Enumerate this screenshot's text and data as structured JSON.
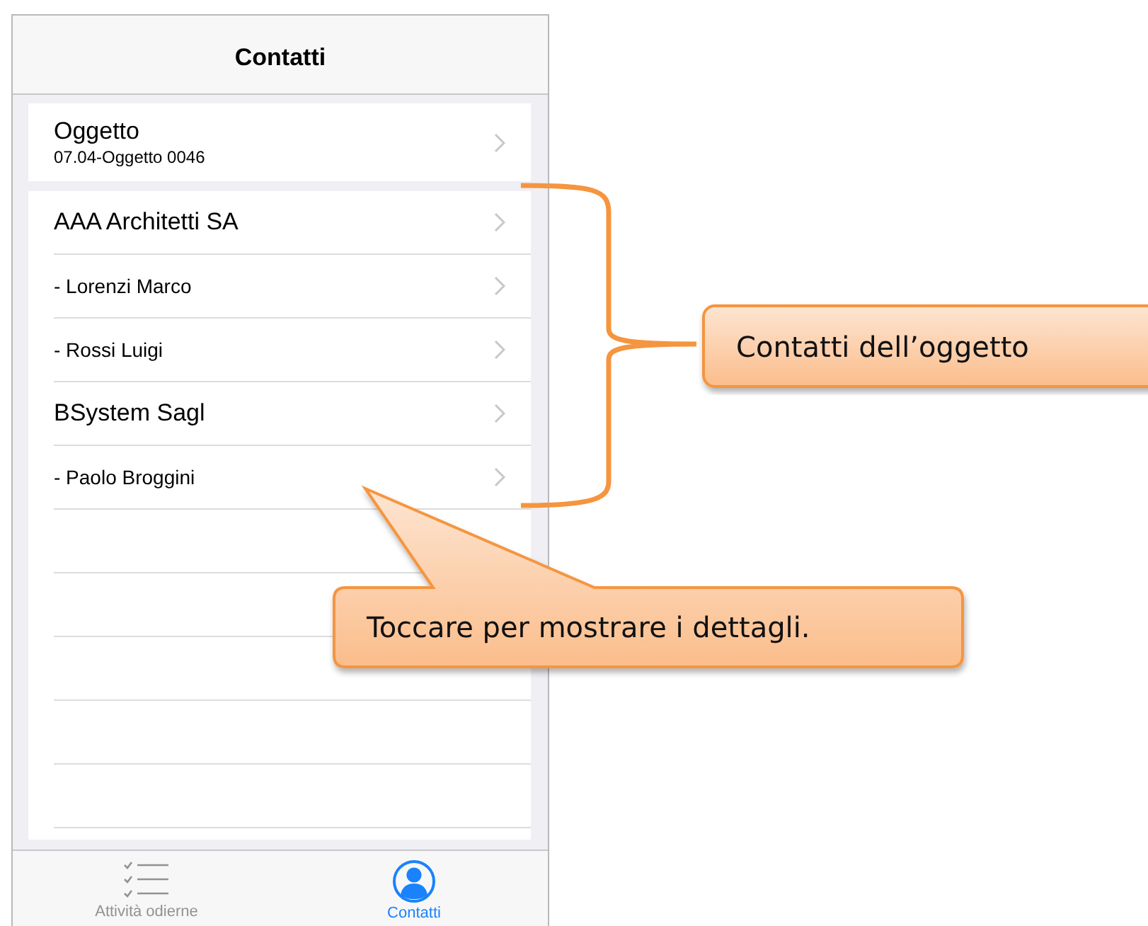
{
  "nav_bar": {
    "title": "Contatti"
  },
  "object_section": {
    "title": "Oggetto",
    "subtitle": "07.04-Oggetto 0046"
  },
  "contacts": [
    {
      "kind": "company",
      "name": "AAA Architetti SA"
    },
    {
      "kind": "person",
      "name": "- Lorenzi Marco"
    },
    {
      "kind": "person",
      "name": "- Rossi Luigi"
    },
    {
      "kind": "company",
      "name": "BSystem Sagl"
    },
    {
      "kind": "person",
      "name": "- Paolo Broggini"
    }
  ],
  "tab_bar": [
    {
      "label": "Attività odierne",
      "kind": "tasks",
      "selected": false
    },
    {
      "label": "Contatti",
      "kind": "contacts",
      "selected": true
    }
  ],
  "callouts": [
    {
      "kind": "brace",
      "text": "Contatti dell’oggetto"
    },
    {
      "kind": "pointer",
      "text": "Toccare per mostrare i dettagli."
    }
  ]
}
